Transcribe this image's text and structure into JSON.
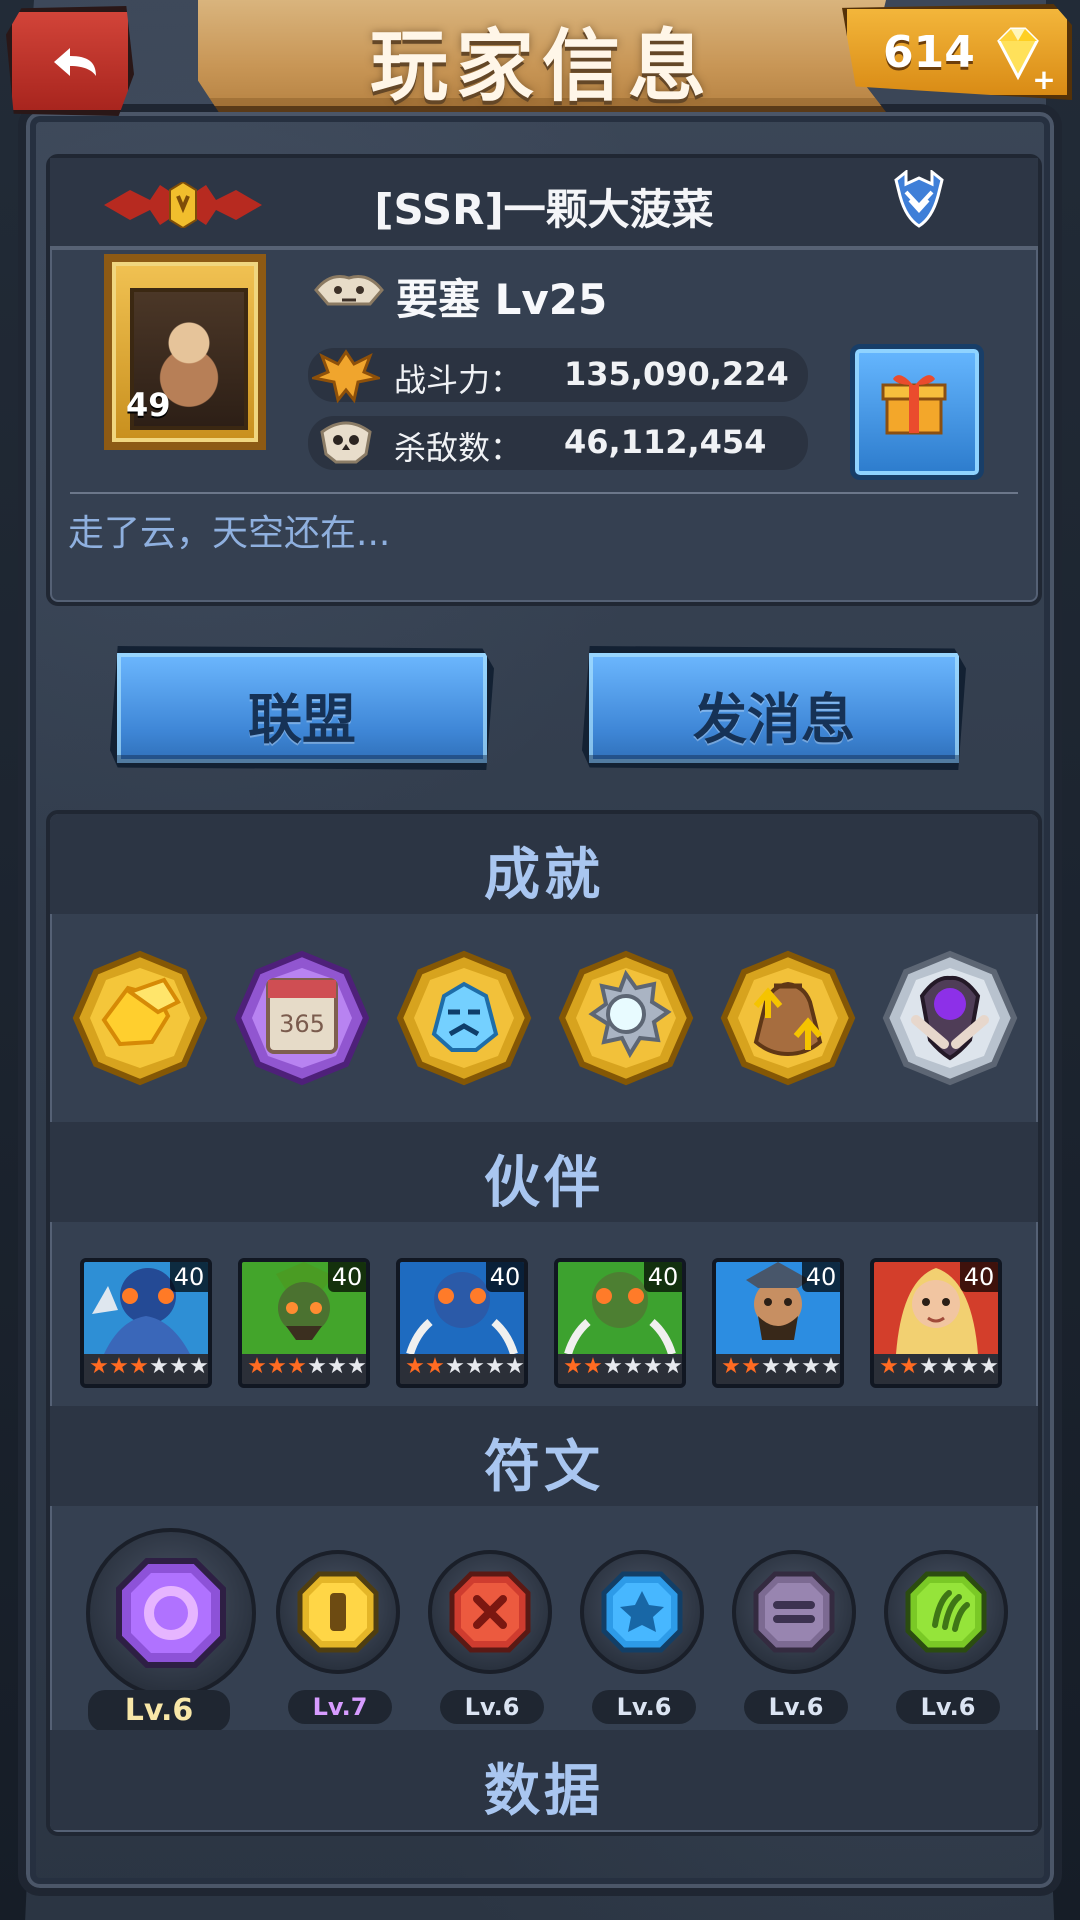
{
  "header": {
    "title": "玩家信息",
    "gem_count": "614",
    "icons": {
      "back": "back-arrow-icon",
      "gem": "gem-icon",
      "plus": "plus-icon"
    }
  },
  "player": {
    "rank_icon": "rank-emblem-icon",
    "name": "[SSR]一颗大菠菜",
    "guild_icon": "guild-badge-icon",
    "avatar_level": "49",
    "fort_label": "要塞 Lv25",
    "power_label": "战斗力：",
    "power_value": "135,090,224",
    "kills_label": "杀敌数：",
    "kills_value": "46,112,454",
    "motto": "走了云，天空还在..."
  },
  "actions": {
    "alliance_label": "联盟",
    "message_label": "发消息"
  },
  "sections": {
    "achievement": "成就",
    "partner": "伙伴",
    "rune": "符文",
    "data": "数据"
  },
  "achievements": [
    {
      "name": "gold-ore-achievement-icon"
    },
    {
      "name": "calendar-365-achievement-icon"
    },
    {
      "name": "ice-beast-achievement-icon"
    },
    {
      "name": "silver-gear-achievement-icon"
    },
    {
      "name": "money-bag-upgrade-achievement-icon"
    },
    {
      "name": "dark-shield-achievement-icon"
    }
  ],
  "partners": [
    {
      "level": "40",
      "stars": [
        true,
        true,
        true,
        false,
        false,
        false
      ]
    },
    {
      "level": "40",
      "stars": [
        true,
        true,
        true,
        false,
        false,
        false
      ]
    },
    {
      "level": "40",
      "stars": [
        true,
        true,
        false,
        false,
        false,
        false
      ]
    },
    {
      "level": "40",
      "stars": [
        true,
        true,
        false,
        false,
        false,
        false
      ]
    },
    {
      "level": "40",
      "stars": [
        true,
        true,
        false,
        false,
        false,
        false
      ]
    },
    {
      "level": "40",
      "stars": [
        true,
        true,
        false,
        false,
        false,
        false
      ]
    }
  ],
  "runes": [
    {
      "level": "Lv.6",
      "icon": "purple-ring-rune-icon",
      "accent": "#8d52d8"
    },
    {
      "level": "Lv.7",
      "icon": "yellow-bar-rune-icon",
      "accent": "#e4b628"
    },
    {
      "level": "Lv.6",
      "icon": "red-cross-rune-icon",
      "accent": "#cf3c2f"
    },
    {
      "level": "Lv.6",
      "icon": "blue-star-rune-icon",
      "accent": "#2d9be8"
    },
    {
      "level": "Lv.6",
      "icon": "gray-line-rune-icon",
      "accent": "#7c6a92"
    },
    {
      "level": "Lv.6",
      "icon": "green-claw-rune-icon",
      "accent": "#7ac926"
    }
  ]
}
